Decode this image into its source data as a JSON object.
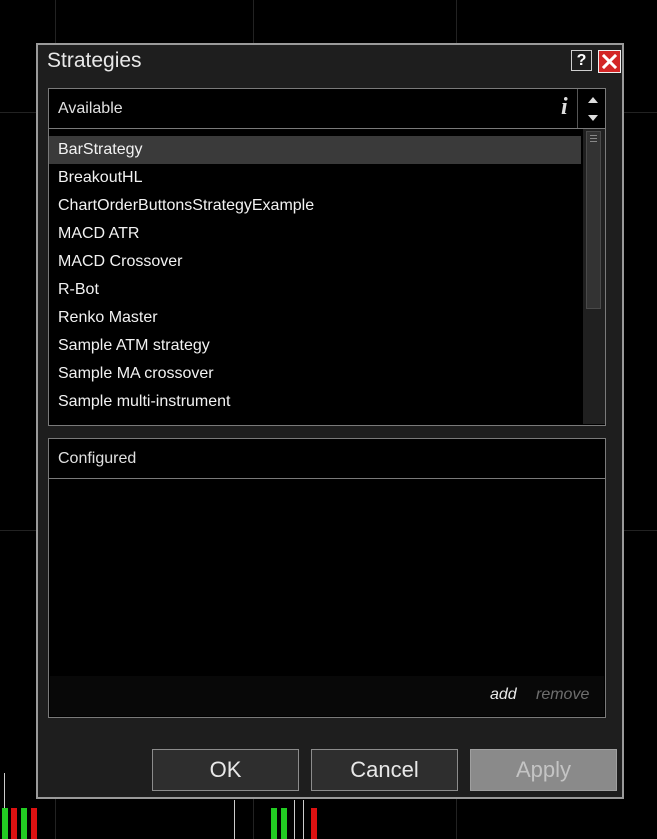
{
  "dialog": {
    "title": "Strategies",
    "help_label": "?"
  },
  "available": {
    "title": "Available",
    "items": [
      "BarStrategy",
      "BreakoutHL",
      "ChartOrderButtonsStrategyExample",
      "MACD ATR",
      "MACD Crossover",
      "R-Bot",
      "Renko Master",
      "Sample ATM strategy",
      "Sample MA crossover",
      "Sample multi-instrument"
    ],
    "selected_index": 0
  },
  "configured": {
    "title": "Configured",
    "add_label": "add",
    "remove_label": "remove"
  },
  "buttons": {
    "ok": "OK",
    "cancel": "Cancel",
    "apply": "Apply"
  },
  "colors": {
    "close_button": "#d32626",
    "background": "#000000",
    "dialog": "#1e1e1e",
    "candle_up": "#22cc22",
    "candle_down": "#dd1111"
  }
}
